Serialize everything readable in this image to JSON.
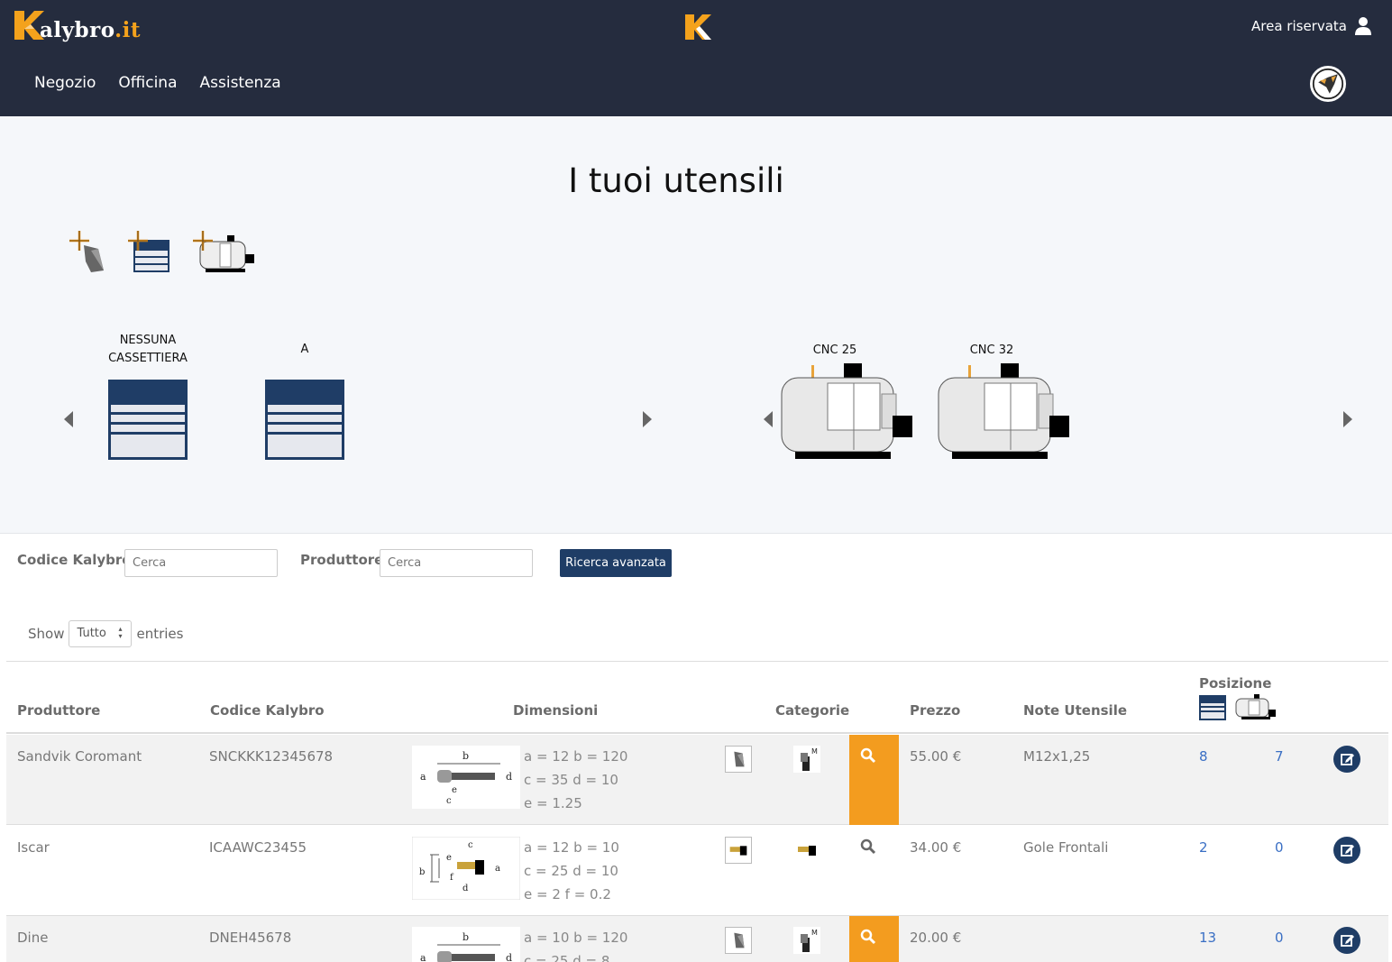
{
  "header": {
    "brand_main": "alybro",
    "brand_tld": ".it",
    "area_label": "Area riservata",
    "nav": [
      "Negozio",
      "Officina",
      "Assistenza"
    ]
  },
  "hero": {
    "title": "I tuoi utensili",
    "add_icons": [
      "add-tool-icon",
      "add-drawer-icon",
      "add-machine-icon"
    ],
    "drawers": [
      {
        "label_line1": "NESSUNA",
        "label_line2": "CASSETTIERA"
      },
      {
        "label_line1": "A",
        "label_line2": ""
      }
    ],
    "machines": [
      {
        "label": "CNC 25"
      },
      {
        "label": "CNC 32"
      }
    ]
  },
  "filters": {
    "code_label": "Codice Kalybro",
    "code_placeholder": "Cerca",
    "producer_label": "Produttore",
    "producer_placeholder": "Cerca",
    "advanced_button": "Ricerca avanzata"
  },
  "entries": {
    "show": "Show",
    "selected": "Tutto",
    "suffix": "entries"
  },
  "table": {
    "headers": {
      "producer": "Produttore",
      "code": "Codice Kalybro",
      "dimensions": "Dimensioni",
      "categories": "Categorie",
      "price": "Prezzo",
      "notes": "Note Utensile",
      "position": "Posizione"
    },
    "rows": [
      {
        "producer": "Sandvik Coromant",
        "code": "SNCKKK12345678",
        "dim1": "a = 12 b = 120",
        "dim2": "c = 35 d = 10",
        "dim3": "e = 1.25",
        "price": "55.00 €",
        "notes": "M12x1,25",
        "pos_drawer": "8",
        "pos_machine": "7"
      },
      {
        "producer": "Iscar",
        "code": "ICAAWC23455",
        "dim1": "a = 12 b = 10",
        "dim2": "c = 25 d = 10",
        "dim3": "e = 2 f = 0.2",
        "price": "34.00 €",
        "notes": "Gole Frontali",
        "pos_drawer": "2",
        "pos_machine": "0"
      },
      {
        "producer": "Dine",
        "code": "DNEH45678",
        "dim1": "a = 10 b = 120",
        "dim2": "c = 25 d = 8",
        "dim3": "",
        "price": "20.00 €",
        "notes": "",
        "pos_drawer": "13",
        "pos_machine": "0"
      }
    ]
  },
  "colors": {
    "header_bg": "#252c3e",
    "accent_orange": "#f39c1f",
    "button_navy": "#1f3d66",
    "link_blue": "#3a6fc4"
  }
}
